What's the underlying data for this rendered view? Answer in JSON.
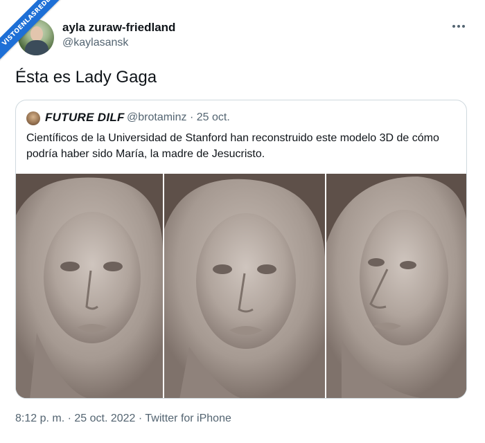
{
  "watermark": {
    "text": "VISTOENLASREDES"
  },
  "tweet": {
    "author": {
      "display_name": "ayla zuraw-friedland",
      "handle": "@kaylasansk"
    },
    "more_icon": "more-horizontal-icon",
    "text": "Ésta es Lady Gaga",
    "timestamp": "8:12 p. m. · 25 oct. 2022 · ",
    "source": "Twitter for iPhone"
  },
  "quote": {
    "author": {
      "display_name": "FUTURE DILF",
      "handle": "@brotaminz",
      "date": "· 25 oct."
    },
    "text": "Científicos de la Universidad de Stanford han reconstruido este modelo 3D de cómo podría haber sido María, la madre de Jesucristo.",
    "image": {
      "description_icon": "sculpted-face-render-image",
      "panels": 3,
      "background_color": "#5e5049",
      "sculpt_color": "#b9aea6"
    }
  }
}
